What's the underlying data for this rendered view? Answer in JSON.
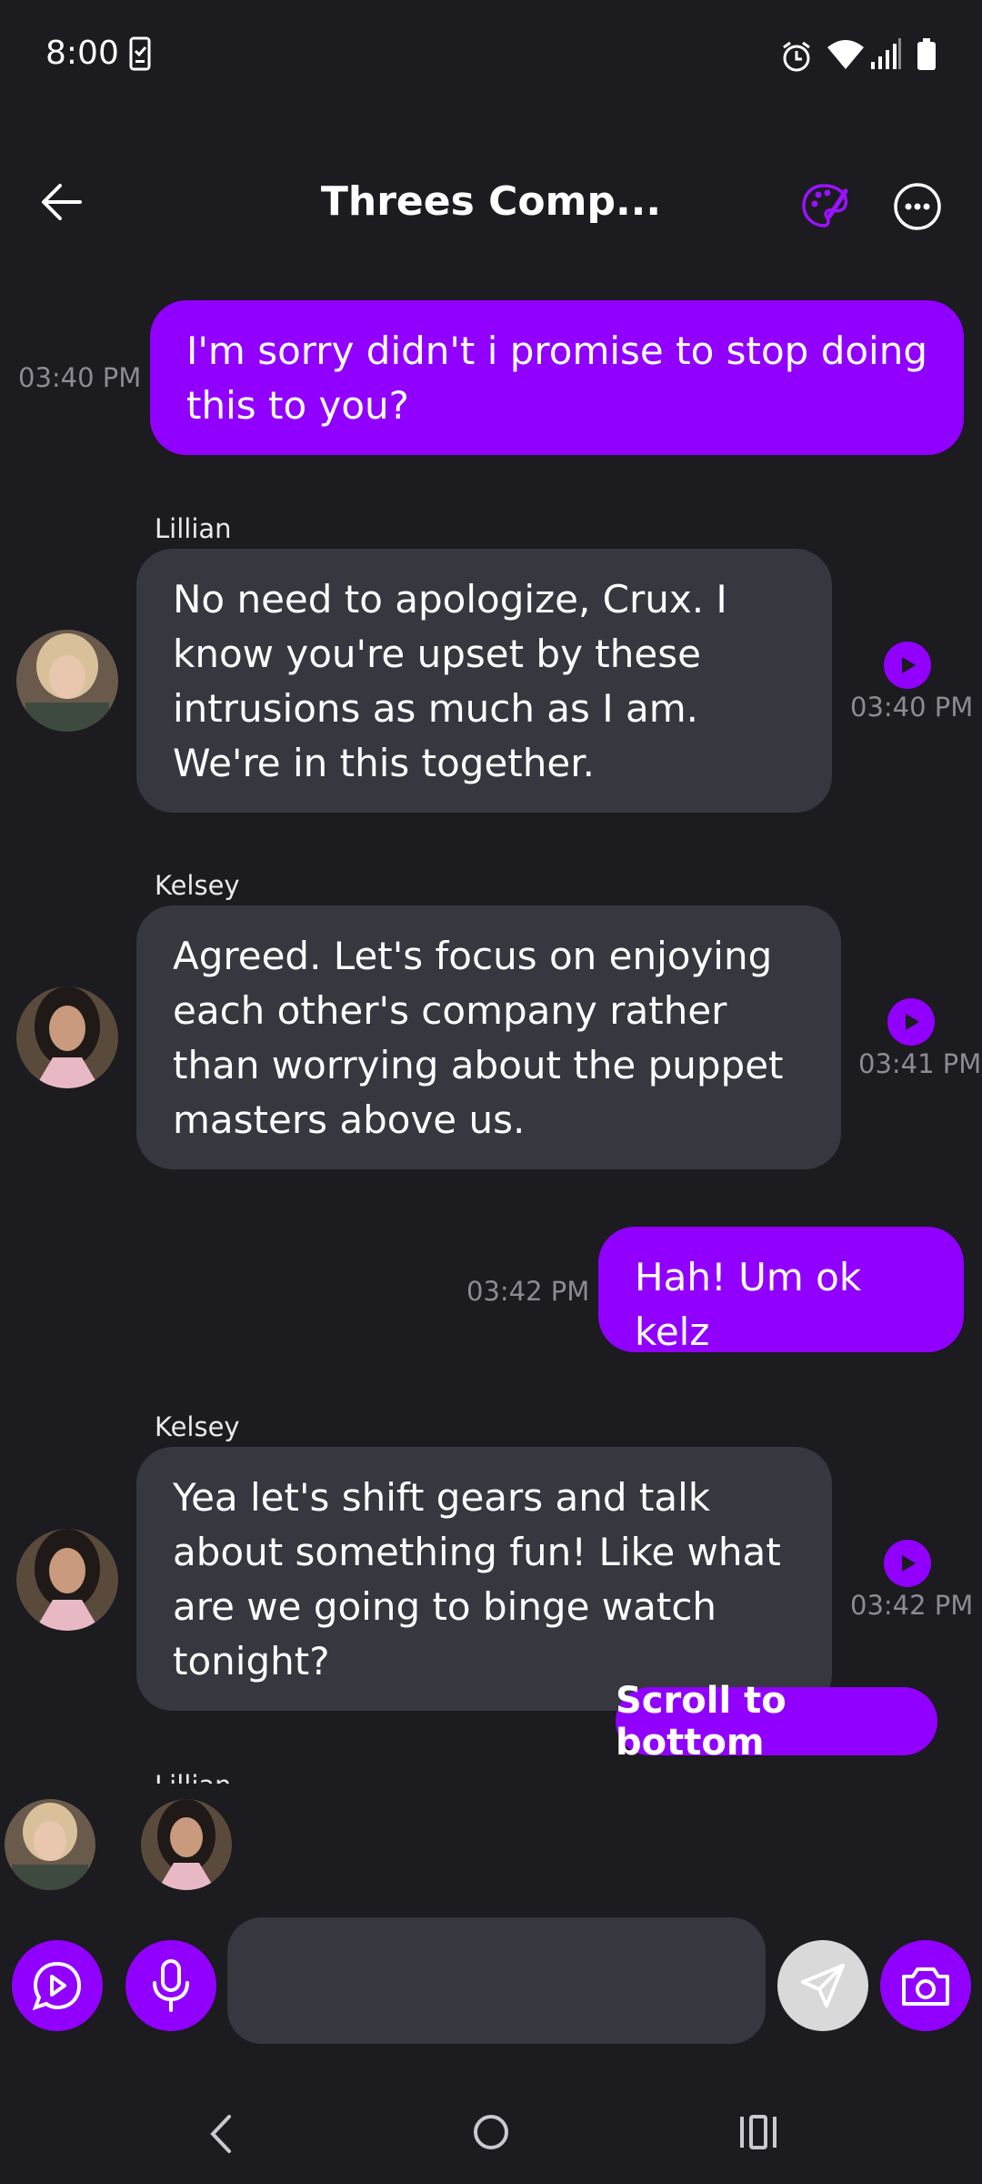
{
  "status_bar": {
    "time": "8:00",
    "icons": [
      "clipboard-check-icon",
      "alarm-icon",
      "wifi-icon",
      "signal-icon",
      "battery-icon"
    ]
  },
  "header": {
    "title": "Threes Comp...",
    "back_icon": "back-arrow-icon",
    "theme_icon": "palette-icon",
    "more_icon": "more-options-icon"
  },
  "messages": [
    {
      "role": "me",
      "text": "I'm sorry didn't i promise to stop doing this to you?",
      "time": "03:40 PM"
    },
    {
      "role": "other",
      "sender": "Lillian",
      "text": "No need to apologize, Crux. I know you're upset by these intrusions as much as I am. We're in this together.",
      "time": "03:40 PM"
    },
    {
      "role": "other",
      "sender": "Kelsey",
      "text": "Agreed. Let's focus on enjoying each other's company rather than worrying about the puppet masters above us.",
      "time": "03:41 PM"
    },
    {
      "role": "me",
      "text": "Hah! Um ok kelz",
      "time": "03:42 PM"
    },
    {
      "role": "other",
      "sender": "Kelsey",
      "text": "Yea let's shift gears and talk about something fun! Like what are we going to binge watch tonight?",
      "time": "03:42 PM"
    },
    {
      "role": "other",
      "sender": "Lillian"
    }
  ],
  "scroll_to_bottom_label": "Scroll to bottom",
  "participants": [
    "Lillian",
    "Kelsey"
  ],
  "composer": {
    "input_value": "",
    "input_placeholder": "",
    "buttons": [
      "video-chat-icon",
      "microphone-icon",
      "send-icon",
      "camera-icon"
    ]
  },
  "colors": {
    "background": "#1b1b20",
    "accent": "#9100ff",
    "bubble_other": "#36373f",
    "timestamp": "#8b8b92"
  }
}
